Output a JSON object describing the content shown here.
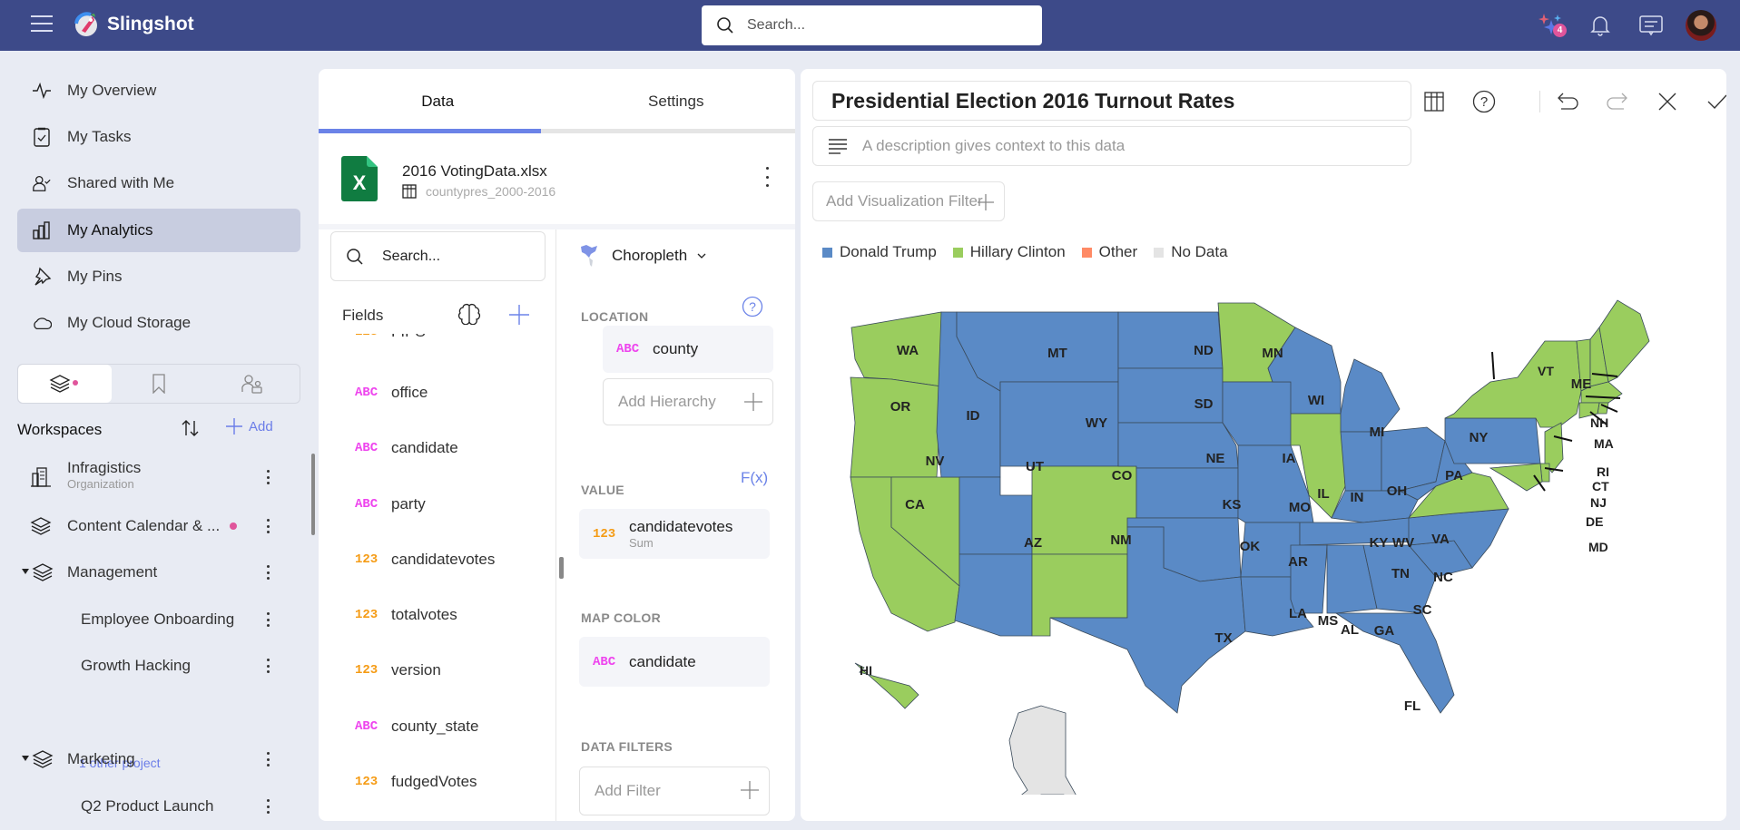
{
  "app": {
    "name": "Slingshot",
    "search_placeholder": "Search...",
    "notification_badge": "4"
  },
  "sidebar": {
    "nav": [
      {
        "label": "My Overview",
        "icon": "pulse-icon"
      },
      {
        "label": "My Tasks",
        "icon": "clipboard-check-icon"
      },
      {
        "label": "Shared with Me",
        "icon": "user-check-icon"
      },
      {
        "label": "My Analytics",
        "icon": "bar-chart-icon",
        "active": true
      },
      {
        "label": "My Pins",
        "icon": "pin-icon"
      },
      {
        "label": "My Cloud Storage",
        "icon": "cloud-icon"
      }
    ],
    "segments": [
      "workspaces",
      "bookmarks",
      "people"
    ],
    "workspaces_title": "Workspaces",
    "add_label": "Add",
    "workspaces": [
      {
        "label": "Infragistics",
        "sub": "Organization",
        "icon": "building-icon"
      },
      {
        "label": "Content Calendar & ...",
        "icon": "layers-icon",
        "unread": true
      },
      {
        "label": "Management",
        "icon": "layers-icon",
        "expanded": true
      },
      {
        "label": "Employee Onboarding",
        "child": true
      },
      {
        "label": "Growth Hacking",
        "child": true
      },
      {
        "label": "Marketing",
        "icon": "layers-icon",
        "expanded": true
      },
      {
        "label": "Q2 Product Launch",
        "child": true
      }
    ],
    "other_projects": "1 other project"
  },
  "editor": {
    "tabs": [
      {
        "label": "Data",
        "active": true
      },
      {
        "label": "Settings"
      }
    ],
    "file": {
      "name": "2016 VotingData.xlsx",
      "sheet": "countypres_2000-2016"
    },
    "field_search_placeholder": "Search...",
    "fields_title": "Fields",
    "fields": [
      {
        "type": "123",
        "name": "FIPS"
      },
      {
        "type": "ABC",
        "name": "office"
      },
      {
        "type": "ABC",
        "name": "candidate"
      },
      {
        "type": "ABC",
        "name": "party"
      },
      {
        "type": "123",
        "name": "candidatevotes"
      },
      {
        "type": "123",
        "name": "totalvotes"
      },
      {
        "type": "123",
        "name": "version"
      },
      {
        "type": "ABC",
        "name": "county_state"
      },
      {
        "type": "123",
        "name": "fudgedVotes"
      }
    ],
    "viz_type": "Choropleth",
    "location_label": "LOCATION",
    "location_field": {
      "type": "ABC",
      "name": "county"
    },
    "add_hierarchy": "Add Hierarchy",
    "value_label": "VALUE",
    "fx_label": "F(x)",
    "value_field": {
      "type": "123",
      "name": "candidatevotes",
      "agg": "Sum"
    },
    "map_color_label": "MAP COLOR",
    "map_color_field": {
      "type": "ABC",
      "name": "candidate"
    },
    "data_filters_label": "DATA FILTERS",
    "add_filter": "Add Filter"
  },
  "visualization": {
    "title": "Presidential Election 2016 Turnout Rates",
    "description_placeholder": "A description gives context to this data",
    "add_viz_filter": "Add Visualization Filter",
    "legend": [
      {
        "label": "Donald Trump",
        "color": "#5a8ac6"
      },
      {
        "label": "Hillary Clinton",
        "color": "#9acd5e"
      },
      {
        "label": "Other",
        "color": "#ff8a65"
      },
      {
        "label": "No Data",
        "color": "#e4e4e4"
      }
    ],
    "states": {
      "Trump": [
        "MT",
        "ND",
        "SD",
        "WY",
        "ID",
        "NE",
        "UT",
        "KS",
        "AZ",
        "OK",
        "TX",
        "IA",
        "MO",
        "AR",
        "LA",
        "WI",
        "MI",
        "IN",
        "OH",
        "KY",
        "WV",
        "TN",
        "MS",
        "AL",
        "GA",
        "SC",
        "NC",
        "FL",
        "PA"
      ],
      "Clinton": [
        "WA",
        "OR",
        "CA",
        "NV",
        "CO",
        "NM",
        "MN",
        "IL",
        "VA",
        "NY",
        "VT",
        "NH",
        "ME",
        "MA",
        "RI",
        "CT",
        "NJ",
        "DE",
        "MD",
        "HI"
      ],
      "No Data": [
        "AK"
      ]
    },
    "labels": [
      "WA",
      "OR",
      "CA",
      "NV",
      "ID",
      "MT",
      "WY",
      "UT",
      "CO",
      "AZ",
      "NM",
      "ND",
      "SD",
      "NE",
      "KS",
      "OK",
      "TX",
      "MN",
      "IA",
      "MO",
      "AR",
      "LA",
      "WI",
      "IL",
      "MI",
      "IN",
      "OH",
      "KY",
      "TN",
      "MS",
      "AL",
      "GA",
      "FL",
      "SC",
      "NC",
      "VA",
      "WV",
      "PA",
      "NY",
      "VT",
      "ME",
      "NH",
      "MA",
      "RI",
      "CT",
      "NJ",
      "DE",
      "MD",
      "HI"
    ]
  }
}
